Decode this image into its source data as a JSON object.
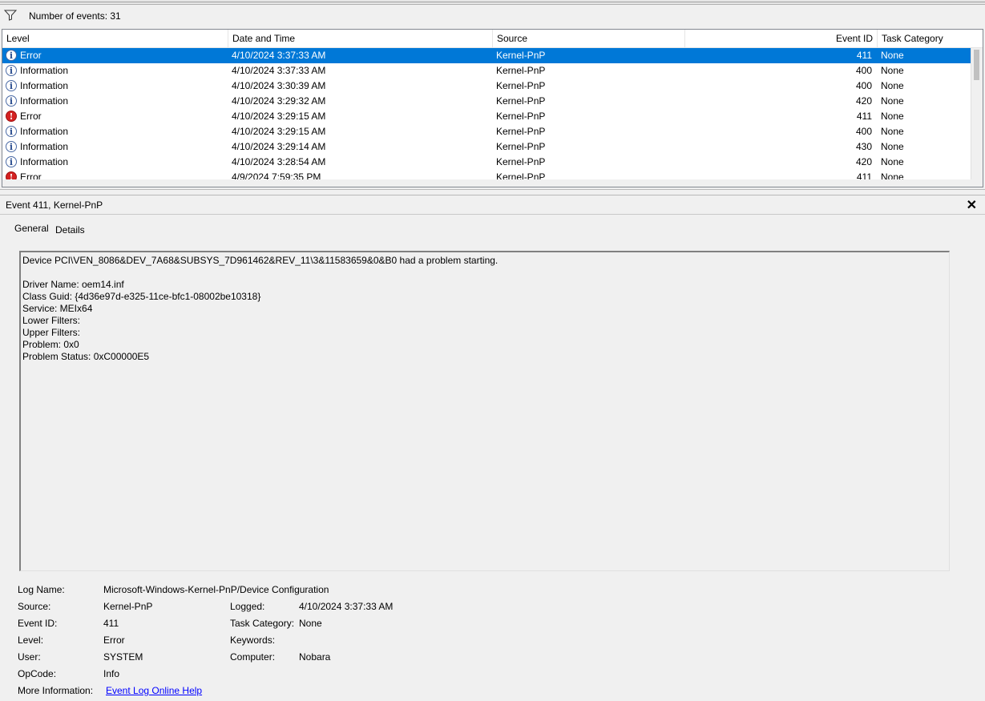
{
  "filter": {
    "icon": "filter-icon",
    "count_label": "Number of events: 31"
  },
  "grid": {
    "columns": [
      "Level",
      "Date and Time",
      "Source",
      "Event ID",
      "Task Category"
    ],
    "rows": [
      {
        "level": "Error",
        "icon": "info",
        "date": "4/10/2024 3:37:33 AM",
        "source": "Kernel-PnP",
        "event_id": "411",
        "task": "None",
        "selected": true
      },
      {
        "level": "Information",
        "icon": "info",
        "date": "4/10/2024 3:37:33 AM",
        "source": "Kernel-PnP",
        "event_id": "400",
        "task": "None"
      },
      {
        "level": "Information",
        "icon": "info",
        "date": "4/10/2024 3:30:39 AM",
        "source": "Kernel-PnP",
        "event_id": "400",
        "task": "None"
      },
      {
        "level": "Information",
        "icon": "info",
        "date": "4/10/2024 3:29:32 AM",
        "source": "Kernel-PnP",
        "event_id": "420",
        "task": "None"
      },
      {
        "level": "Error",
        "icon": "error",
        "date": "4/10/2024 3:29:15 AM",
        "source": "Kernel-PnP",
        "event_id": "411",
        "task": "None"
      },
      {
        "level": "Information",
        "icon": "info",
        "date": "4/10/2024 3:29:15 AM",
        "source": "Kernel-PnP",
        "event_id": "400",
        "task": "None"
      },
      {
        "level": "Information",
        "icon": "info",
        "date": "4/10/2024 3:29:14 AM",
        "source": "Kernel-PnP",
        "event_id": "430",
        "task": "None"
      },
      {
        "level": "Information",
        "icon": "info",
        "date": "4/10/2024 3:28:54 AM",
        "source": "Kernel-PnP",
        "event_id": "420",
        "task": "None"
      },
      {
        "level": "Error",
        "icon": "error",
        "date": "4/9/2024 7:59:35 PM",
        "source": "Kernel-PnP",
        "event_id": "411",
        "task": "None"
      }
    ]
  },
  "detail": {
    "title": "Event 411, Kernel-PnP",
    "tabs": [
      "General",
      "Details"
    ],
    "description": [
      "Device PCI\\VEN_8086&DEV_7A68&SUBSYS_7D961462&REV_11\\3&11583659&0&B0 had a problem starting.",
      "",
      "Driver Name: oem14.inf",
      "Class Guid: {4d36e97d-e325-11ce-bfc1-08002be10318}",
      "Service: MEIx64",
      "Lower Filters:",
      "Upper Filters:",
      "Problem: 0x0",
      "Problem Status: 0xC00000E5"
    ],
    "props": {
      "log_name_label": "Log Name:",
      "log_name": "Microsoft-Windows-Kernel-PnP/Device Configuration",
      "source_label": "Source:",
      "source": "Kernel-PnP",
      "logged_label": "Logged:",
      "logged": "4/10/2024 3:37:33 AM",
      "event_id_label": "Event ID:",
      "event_id": "411",
      "task_category_label": "Task Category:",
      "task_category": "None",
      "level_label": "Level:",
      "level": "Error",
      "keywords_label": "Keywords:",
      "keywords": "",
      "user_label": "User:",
      "user": "SYSTEM",
      "computer_label": "Computer:",
      "computer": "Nobara",
      "opcode_label": "OpCode:",
      "opcode": "Info",
      "more_info_label": "More Information:",
      "more_info_link": "Event Log Online Help"
    }
  },
  "colors": {
    "selection": "#0078d7",
    "error_icon": "#d42222",
    "link": "#0000ff"
  }
}
